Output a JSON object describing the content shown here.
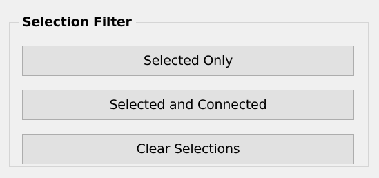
{
  "selection_filter": {
    "title": "Selection Filter",
    "buttons": [
      {
        "label": "Selected Only"
      },
      {
        "label": "Selected and Connected"
      },
      {
        "label": "Clear Selections"
      }
    ]
  },
  "colors": {
    "background": "#f0f0f0",
    "button_face": "#e1e1e1",
    "button_border": "#adadad",
    "group_border": "#d5d5d5"
  }
}
